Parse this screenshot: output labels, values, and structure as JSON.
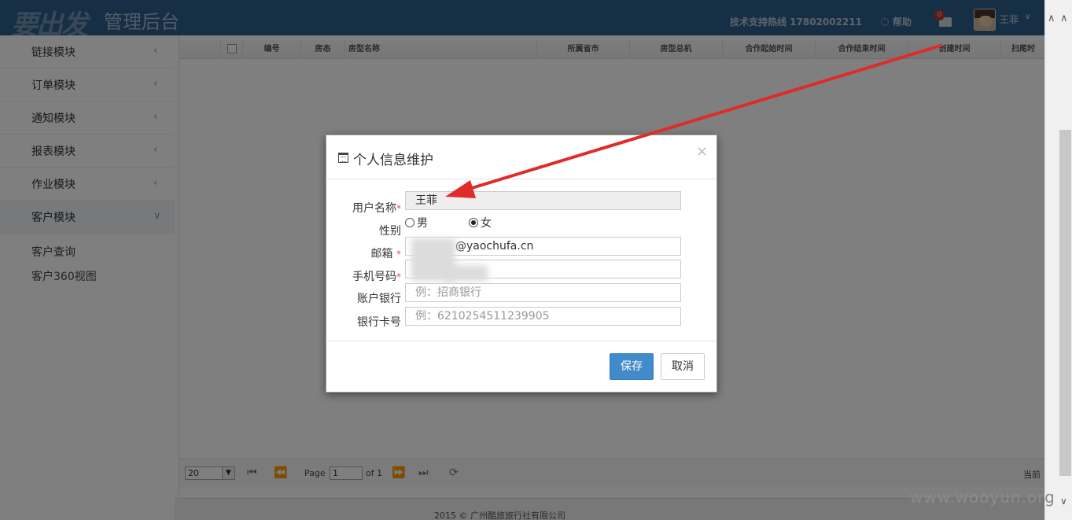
{
  "header": {
    "logo": "要出发",
    "subtitle": "管理后台",
    "hotline": "技术支持热线 17802002211",
    "help": "帮助",
    "mail_badge": "0",
    "user_name": "王菲"
  },
  "sidebar": {
    "items": [
      {
        "label": "链接模块"
      },
      {
        "label": "订单模块"
      },
      {
        "label": "通知模块"
      },
      {
        "label": "报表模块"
      },
      {
        "label": "作业模块"
      },
      {
        "label": "客户模块"
      }
    ],
    "sub_items": [
      {
        "label": "客户查询"
      },
      {
        "label": "客户360视图"
      }
    ]
  },
  "grid": {
    "columns": [
      "编号",
      "房态",
      "房型名称",
      "所属省市",
      "房型总机",
      "合作起始时间",
      "合作结束时间",
      "创建时间",
      "扫尾时"
    ]
  },
  "pager": {
    "page_size": "20",
    "page_label": "Page",
    "page_value": "1",
    "of_label": "of 1",
    "right_label": "当前"
  },
  "footer": "2015 © 广州酷旅旅行社有限公司",
  "watermark": "www.wooyun.org",
  "modal": {
    "title": "个人信息维护",
    "close": "×",
    "fields": {
      "username_label": "用户名称",
      "username_value": "王菲",
      "gender_label": "性别",
      "gender_male": "男",
      "gender_female": "女",
      "email_label": "邮箱",
      "email_value": "@yaochufa.cn",
      "phone_label": "手机号码",
      "bank_label": "账户银行",
      "bank_placeholder": "例：招商银行",
      "card_label": "银行卡号",
      "card_placeholder": "例：6210254511239905"
    },
    "required_mark": "*",
    "save": "保存",
    "cancel": "取消"
  },
  "colors": {
    "header_bg": "#2e5f8a",
    "primary_button": "#428bca",
    "required": "#d9534f",
    "annotation_arrow": "#e02b2b"
  }
}
